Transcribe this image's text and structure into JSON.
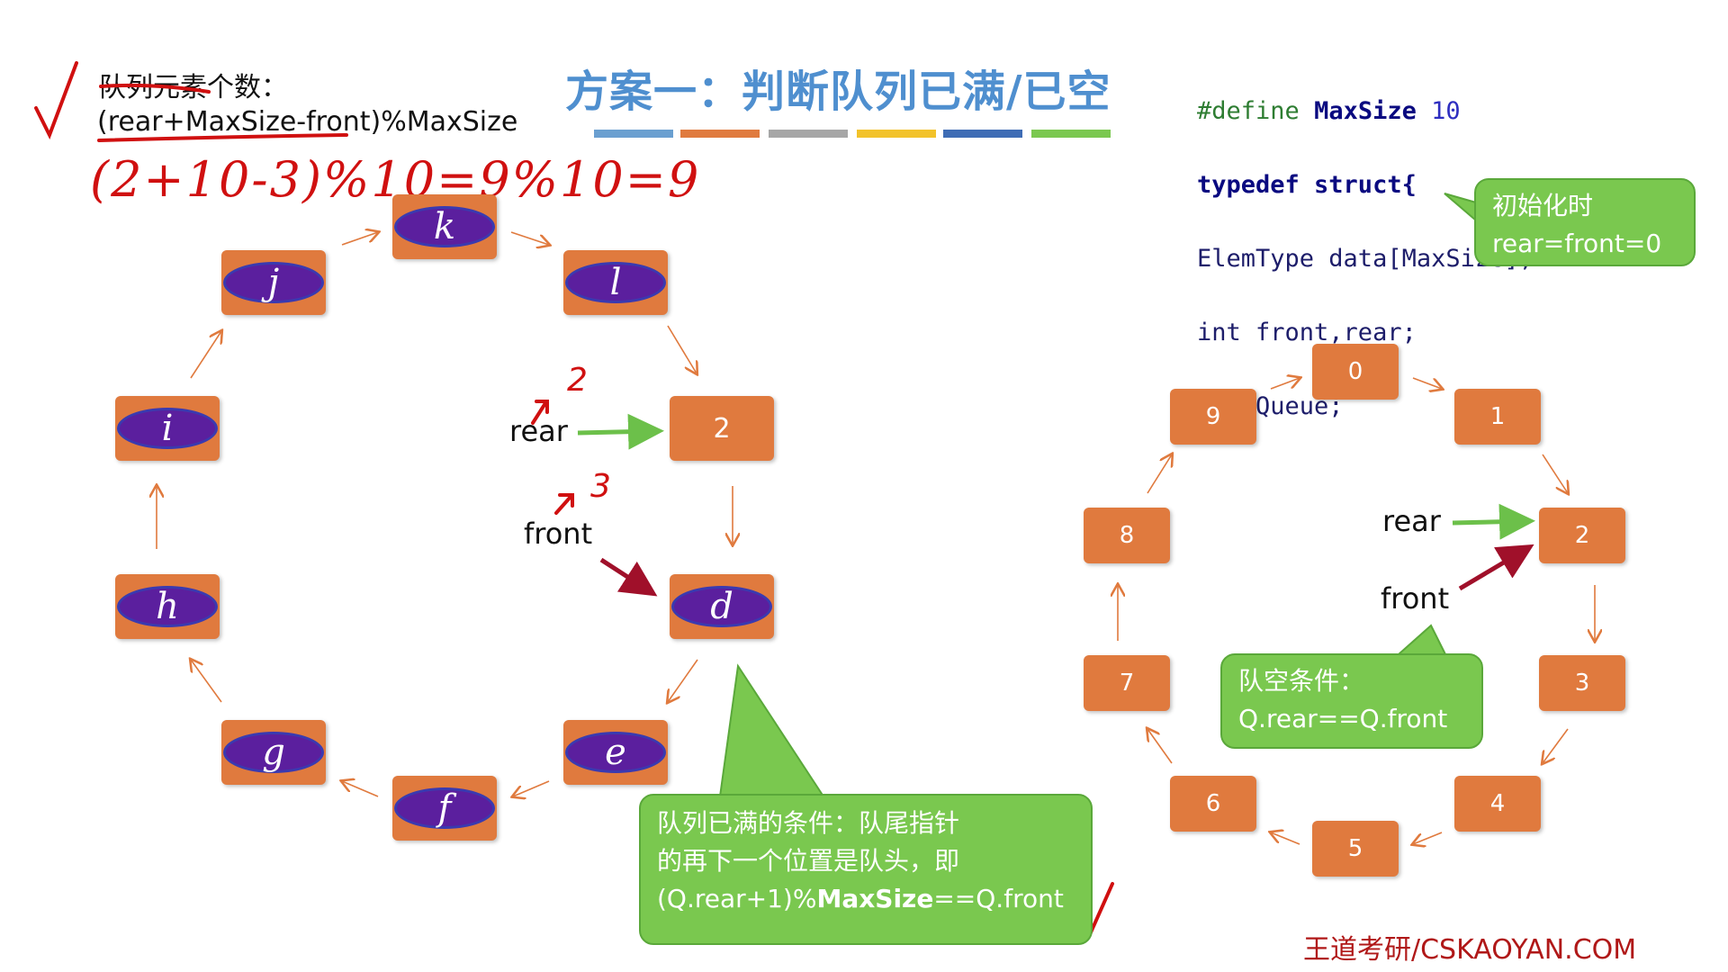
{
  "title": "方案一：判断队列已满/已空",
  "count_heading": "队列元素个数：",
  "count_formula": "(rear+MaxSize-front)%MaxSize",
  "handwritten_calc": "(2+10-3)%10=9%10=9",
  "code": {
    "line1_pp": "#define",
    "line1_name": "MaxSize",
    "line1_num": "10",
    "line2": "typedef struct{",
    "line3": "ElemType data[MaxSize];",
    "line4": "int front,rear;",
    "line5": "} SqQueue;"
  },
  "init_callout": [
    "初始化时",
    "rear=front=0"
  ],
  "left_ring": {
    "nodes": [
      {
        "id": "k",
        "text": "k",
        "kind": "elem"
      },
      {
        "id": "l",
        "text": "l",
        "kind": "elem"
      },
      {
        "id": "2",
        "text": "2",
        "kind": "num"
      },
      {
        "id": "d",
        "text": "d",
        "kind": "elem"
      },
      {
        "id": "e",
        "text": "e",
        "kind": "elem"
      },
      {
        "id": "f",
        "text": "f",
        "kind": "elem"
      },
      {
        "id": "g",
        "text": "g",
        "kind": "elem"
      },
      {
        "id": "h",
        "text": "h",
        "kind": "elem"
      },
      {
        "id": "i",
        "text": "i",
        "kind": "elem"
      },
      {
        "id": "j",
        "text": "j",
        "kind": "elem"
      }
    ],
    "rear_label": "rear",
    "front_label": "front",
    "rear_annot": "2",
    "front_annot": "3"
  },
  "full_callout": [
    "队列已满的条件：队尾指针",
    "的再下一个位置是队头，即"
  ],
  "full_formula_a": "(Q.rear+1)%",
  "full_formula_b": "MaxSize",
  "full_formula_c": "==",
  "full_formula_d": "Q.front",
  "right_ring": {
    "nodes": [
      "0",
      "1",
      "2",
      "3",
      "4",
      "5",
      "6",
      "7",
      "8",
      "9"
    ],
    "rear_label": "rear",
    "front_label": "front"
  },
  "empty_callout": [
    "队空条件：",
    "Q.rear==Q.front"
  ],
  "watermark": "王道考研/CSKAOYAN.COM",
  "colors": {
    "node": "#e07a3e",
    "ellipse": "#5b1f9e",
    "callout": "#7ac84f",
    "title": "#4f8fcf",
    "ink": "#d01010",
    "arrow_green": "#6cc04a",
    "arrow_red": "#a0102a"
  }
}
